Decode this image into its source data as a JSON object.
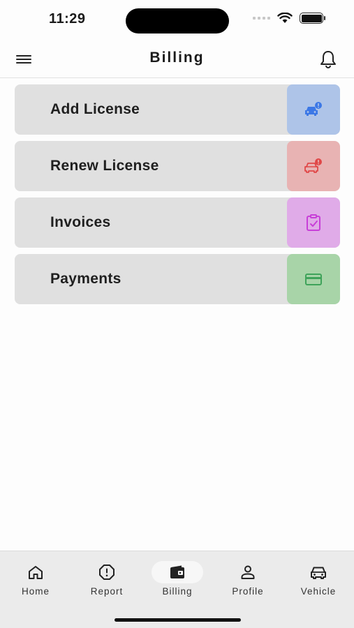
{
  "status_bar": {
    "time": "11:29"
  },
  "header": {
    "title": "Billing"
  },
  "cards": [
    {
      "label": "Add License",
      "icon": "car-info-icon",
      "bg": "#aec4e8",
      "icon_color": "#3c78e6"
    },
    {
      "label": "Renew License",
      "icon": "car-alert-icon",
      "bg": "#e8b3b3",
      "icon_color": "#e04848"
    },
    {
      "label": "Invoices",
      "icon": "clipboard-check-icon",
      "bg": "#e0abe8",
      "icon_color": "#c83fd8"
    },
    {
      "label": "Payments",
      "icon": "credit-card-icon",
      "bg": "#a8d4a8",
      "icon_color": "#3fa35a"
    }
  ],
  "bottom_nav": [
    {
      "label": "Home",
      "icon": "home-icon",
      "active": false
    },
    {
      "label": "Report",
      "icon": "report-icon",
      "active": false
    },
    {
      "label": "Billing",
      "icon": "wallet-icon",
      "active": true
    },
    {
      "label": "Profile",
      "icon": "profile-icon",
      "active": false
    },
    {
      "label": "Vehicle",
      "icon": "car-icon",
      "active": false
    }
  ]
}
